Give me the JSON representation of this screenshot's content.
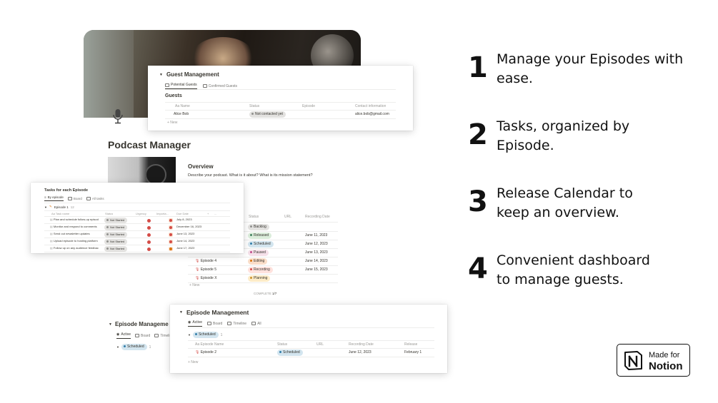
{
  "features": [
    {
      "num": "1",
      "line1": "Manage your Episodes with",
      "line2": "ease."
    },
    {
      "num": "2",
      "line1": "Tasks, organized by",
      "line2": "Episode."
    },
    {
      "num": "3",
      "line1": "Release Calendar to",
      "line2": "keep an overview."
    },
    {
      "num": "4",
      "line1": "Convenient dashboard",
      "line2": "to manage guests."
    }
  ],
  "badge": {
    "line1": "Made for",
    "line2": "Notion"
  },
  "podcast": {
    "title": "Podcast Manager",
    "overview_title": "Overview",
    "overview_text": "Describe your podcast. What is it about? What is its mission statement?"
  },
  "guest": {
    "title": "Guest Management",
    "tabs": [
      "Potential Guests",
      "Confirmed Guests"
    ],
    "db_title": "Guests",
    "columns": [
      "Aa Name",
      "Status",
      "Episode",
      "Contact information"
    ],
    "rows": [
      {
        "name": "Alice Bob",
        "status": "Not contacted yet",
        "episode": "",
        "contact": "alice.bob@gmail.com"
      }
    ],
    "new_label": "+ New"
  },
  "tasks": {
    "title": "Tasks for each Episode",
    "tabs": [
      "By episode",
      "Board",
      "All tasks"
    ],
    "group": "Episode 1",
    "group_count": "12",
    "columns": [
      "Aa Task name",
      "Status",
      "Urgency",
      "Importa...",
      "Due Date",
      "+",
      "..."
    ],
    "rows": [
      {
        "name": "Plan and schedule follow-up episod",
        "status": "Not Started",
        "due": "July 8, 2023"
      },
      {
        "name": "Monitor and respond to comments",
        "status": "Not Started",
        "due": "December 16, 2023"
      },
      {
        "name": "Send out newsletter updates",
        "status": "Not Started",
        "due": "June 13, 2023"
      },
      {
        "name": "Upload episode to hosting platform",
        "status": "Not Started",
        "due": "June 14, 2023"
      },
      {
        "name": "Follow up on any audience feedbac",
        "status": "Not Started",
        "due": "June 17, 2023"
      }
    ]
  },
  "episodes": {
    "columns": [
      "Status",
      "URL",
      "Recording Date"
    ],
    "rows": [
      {
        "name": "",
        "status": "Backlog",
        "date": ""
      },
      {
        "name": "",
        "status": "Released",
        "date": "June 11, 2023"
      },
      {
        "name": "",
        "status": "Scheduled",
        "date": "June 12, 2023"
      },
      {
        "name": "",
        "status": "Paused",
        "date": "June 13, 2023"
      },
      {
        "name": "Episode 4",
        "status": "Editing",
        "date": "June 14, 2023"
      },
      {
        "name": "Episode 5",
        "status": "Recording",
        "date": "June 15, 2023"
      },
      {
        "name": "Episode X",
        "status": "Planning",
        "date": ""
      }
    ],
    "new_label": "+ New",
    "complete_label": "COMPLETE",
    "complete_value": "1/7"
  },
  "episode_mgmt_back": {
    "title": "Episode Manageme",
    "tabs": [
      "Active",
      "Board",
      "Timeli"
    ],
    "group": "Scheduled",
    "count": "1"
  },
  "episode_mgmt": {
    "title": "Episode Management",
    "tabs": [
      "Active",
      "Board",
      "Timeline",
      "All"
    ],
    "group": "Scheduled",
    "count": "1",
    "columns": [
      "Aa Episode Name",
      "Status",
      "URL",
      "Recording Date",
      "Release"
    ],
    "row": {
      "name": "Episode 2",
      "status": "Scheduled",
      "date": "June 12, 2023",
      "release": "February 1"
    },
    "new_label": "+ New"
  },
  "colors": {
    "backlog": "#e3e2e0",
    "released": "#dbeddb",
    "scheduled": "#d3e5ef",
    "paused": "#f5e0e9",
    "editing": "#fadec9",
    "recording": "#ffe2dd",
    "planning": "#fdecc8",
    "not_started": "#e3e2e0"
  }
}
